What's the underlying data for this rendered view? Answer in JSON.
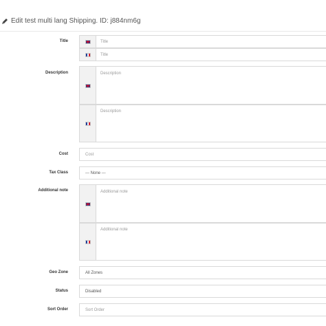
{
  "header": {
    "title": "Edit test multi lang Shipping. ID: j884nm6g"
  },
  "form": {
    "title": {
      "label": "Title",
      "placeholders": [
        "Title",
        "Title"
      ]
    },
    "description": {
      "label": "Description",
      "placeholders": [
        "Description",
        "Description"
      ]
    },
    "cost": {
      "label": "Cost",
      "placeholder": "Cost"
    },
    "tax_class": {
      "label": "Tax Class",
      "value": "--- None ---"
    },
    "additional_note": {
      "label": "Additional note",
      "placeholders": [
        "Additional note",
        "Additional note"
      ]
    },
    "geo_zone": {
      "label": "Geo Zone",
      "value": "All Zones"
    },
    "status": {
      "label": "Status",
      "value": "Disabled"
    },
    "sort_order": {
      "label": "Sort Order",
      "placeholder": "Sort Order"
    }
  },
  "languages": [
    "en-gb-flag-icon",
    "fr-flag-icon"
  ]
}
